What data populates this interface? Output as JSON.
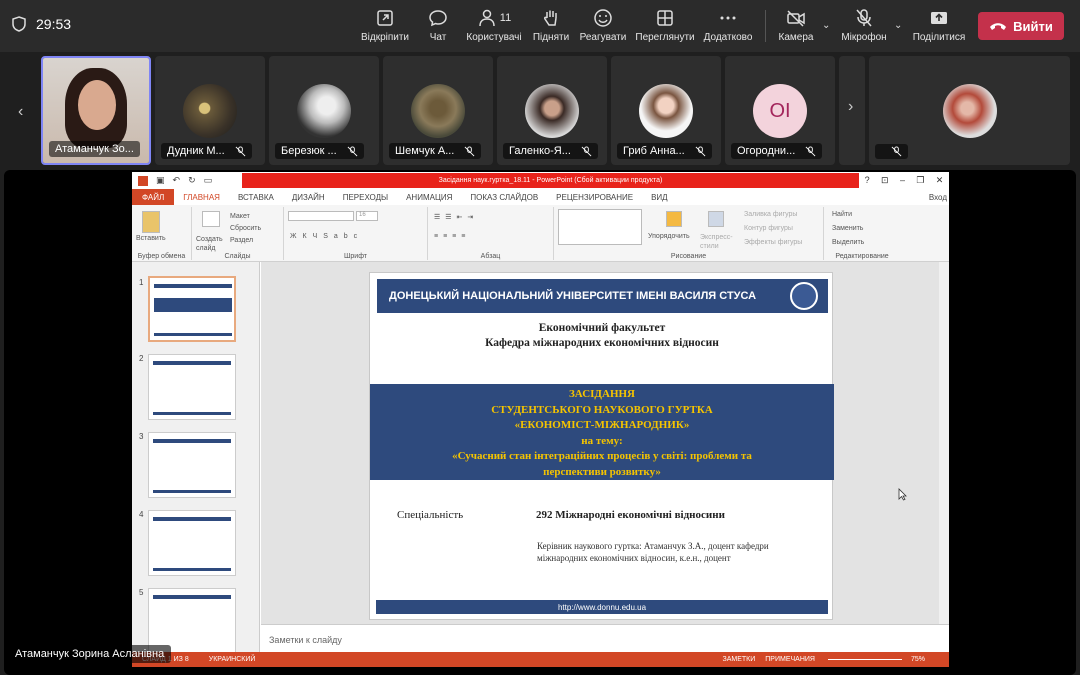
{
  "meeting": {
    "timer": "29:53",
    "toolbar": [
      {
        "label": "Відкріпити",
        "icon": "unpin-icon"
      },
      {
        "label": "Чат",
        "icon": "chat-icon"
      },
      {
        "label": "Користувачі",
        "icon": "people-icon",
        "count": "11"
      },
      {
        "label": "Підняти",
        "icon": "raise-hand-icon"
      },
      {
        "label": "Реагувати",
        "icon": "react-icon"
      },
      {
        "label": "Переглянути",
        "icon": "view-icon"
      },
      {
        "label": "Додатково",
        "icon": "more-icon"
      },
      {
        "label": "Камера",
        "icon": "camera-off-icon"
      },
      {
        "label": "Мікрофон",
        "icon": "mic-off-icon"
      },
      {
        "label": "Поділитися",
        "icon": "share-icon"
      }
    ],
    "leave_label": "Вийти",
    "participants": [
      {
        "name": "Атаманчук Зо...",
        "initials": ""
      },
      {
        "name": "Дудник М...",
        "initials": ""
      },
      {
        "name": "Березюк ...",
        "initials": ""
      },
      {
        "name": "Шемчук А...",
        "initials": ""
      },
      {
        "name": "Галенко-Я...",
        "initials": ""
      },
      {
        "name": "Гриб Анна...",
        "initials": ""
      },
      {
        "name": "Огородни...",
        "initials": "OI"
      },
      {
        "name": "",
        "initials": ""
      }
    ],
    "presenter_label": "Атаманчук Зорина Асланівна"
  },
  "powerpoint": {
    "window_title": "Засідання наук.гуртка_18.11 - PowerPoint (Сбой активации продукта)",
    "signin": "Вход",
    "tabs": [
      "ФАЙЛ",
      "ГЛАВНАЯ",
      "ВСТАВКА",
      "ДИЗАЙН",
      "ПЕРЕХОДЫ",
      "АНИМАЦИЯ",
      "ПОКАЗ СЛАЙДОВ",
      "РЕЦЕНЗИРОВАНИЕ",
      "ВИД"
    ],
    "groups": {
      "clipboard": "Буфер обмена",
      "slides": "Слайды",
      "font": "Шрифт",
      "paragraph": "Абзац",
      "drawing": "Рисование",
      "editing": "Редактирование"
    },
    "ribbon_buttons": {
      "paste": "Вставить",
      "create_slide": "Создать слайд",
      "layout": "Макет",
      "reset": "Сбросить",
      "section": "Раздел",
      "font_size": "16",
      "arrange": "Упорядочить",
      "quick_styles": "Экспресс-стили",
      "fill": "Заливка фигуры",
      "outline": "Контур фигуры",
      "effects": "Эффекты фигуры",
      "find": "Найти",
      "replace": "Заменить",
      "select": "Выделить"
    },
    "thumb_numbers": [
      "1",
      "2",
      "3",
      "4",
      "5"
    ],
    "notes_placeholder": "Заметки к слайду",
    "status": {
      "slide": "СЛАЙД 1 ИЗ 8",
      "language": "УКРАИНСКИЙ",
      "notes": "ЗАМЕТКИ",
      "comments": "ПРИМЕЧАНИЯ",
      "zoom": "75%"
    },
    "slide": {
      "header": "ДОНЕЦЬКИЙ НАЦІОНАЛЬНИЙ УНІВЕРСИТЕТ ІМЕНІ ВАСИЛЯ СТУСА",
      "faculty": "Економічний факультет",
      "department": "Кафедра міжнародних економічних відносин",
      "band_lines": [
        "ЗАСІДАННЯ",
        "СТУДЕНТСЬКОГО НАУКОВОГО ГУРТКА",
        "«ЕКОНОМІСТ-МІЖНАРОДНИК»",
        "на тему:",
        "«Сучасний стан інтеграційних процесів у світі: проблеми та",
        "перспективи розвитку»"
      ],
      "specialty_label": "Спеціальність",
      "specialty_value": "292 Міжнародні економічні відносини",
      "lead_line1": "Керівник наукового гуртка: Атаманчук З.А., доцент кафедри",
      "lead_line2": "міжнародних економічних відносин, к.е.н., доцент",
      "footer_url": "http://www.donnu.edu.ua"
    }
  }
}
